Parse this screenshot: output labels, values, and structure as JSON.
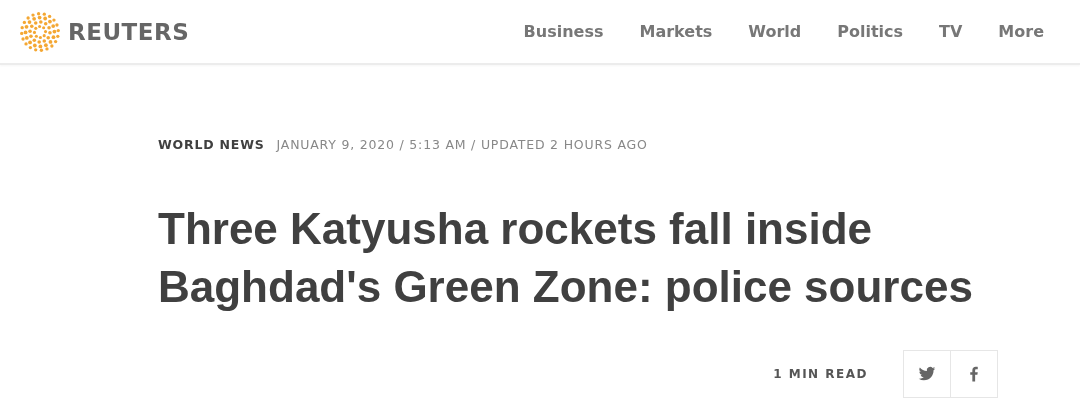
{
  "header": {
    "brand": "REUTERS",
    "nav": [
      {
        "label": "Business"
      },
      {
        "label": "Markets"
      },
      {
        "label": "World"
      },
      {
        "label": "Politics"
      },
      {
        "label": "TV"
      },
      {
        "label": "More"
      }
    ]
  },
  "article": {
    "section": "WORLD NEWS",
    "dateline": "JANUARY 9, 2020 / 5:13 AM / UPDATED 2 HOURS AGO",
    "headline": "Three Katyusha rockets fall inside Baghdad's Green Zone: police sources",
    "read_time": "1 MIN READ",
    "share": [
      {
        "kind": "twitter"
      },
      {
        "kind": "facebook"
      }
    ]
  }
}
